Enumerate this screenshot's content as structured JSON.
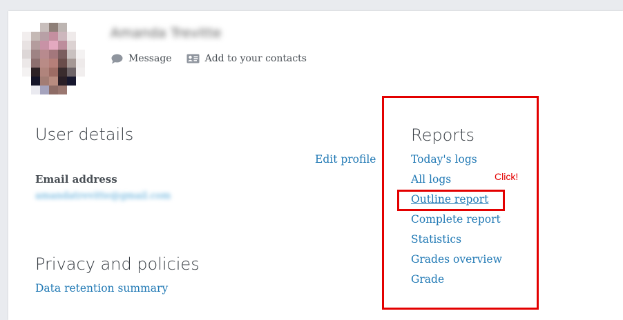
{
  "profile": {
    "name": "Amanda Trevitte",
    "actions": [
      {
        "label": "Message",
        "icon": "speech-bubble-icon"
      },
      {
        "label": "Add to your contacts",
        "icon": "address-card-icon"
      }
    ]
  },
  "user_details": {
    "title": "User details",
    "edit_link": "Edit profile",
    "email_label": "Email address",
    "email_value": "amandatrevitte@gmail.com"
  },
  "privacy": {
    "title": "Privacy and policies",
    "link": "Data retention summary"
  },
  "reports": {
    "title": "Reports",
    "items": [
      {
        "label": "Today's logs"
      },
      {
        "label": "All logs"
      },
      {
        "label": "Outline report"
      },
      {
        "label": "Complete report"
      },
      {
        "label": "Statistics"
      },
      {
        "label": "Grades overview"
      },
      {
        "label": "Grade"
      }
    ]
  },
  "annotation": {
    "callout": "Click!",
    "color": "#e30000"
  },
  "colors": {
    "link": "#1f78b4",
    "background": "#e9ebef",
    "card": "#ffffff"
  }
}
